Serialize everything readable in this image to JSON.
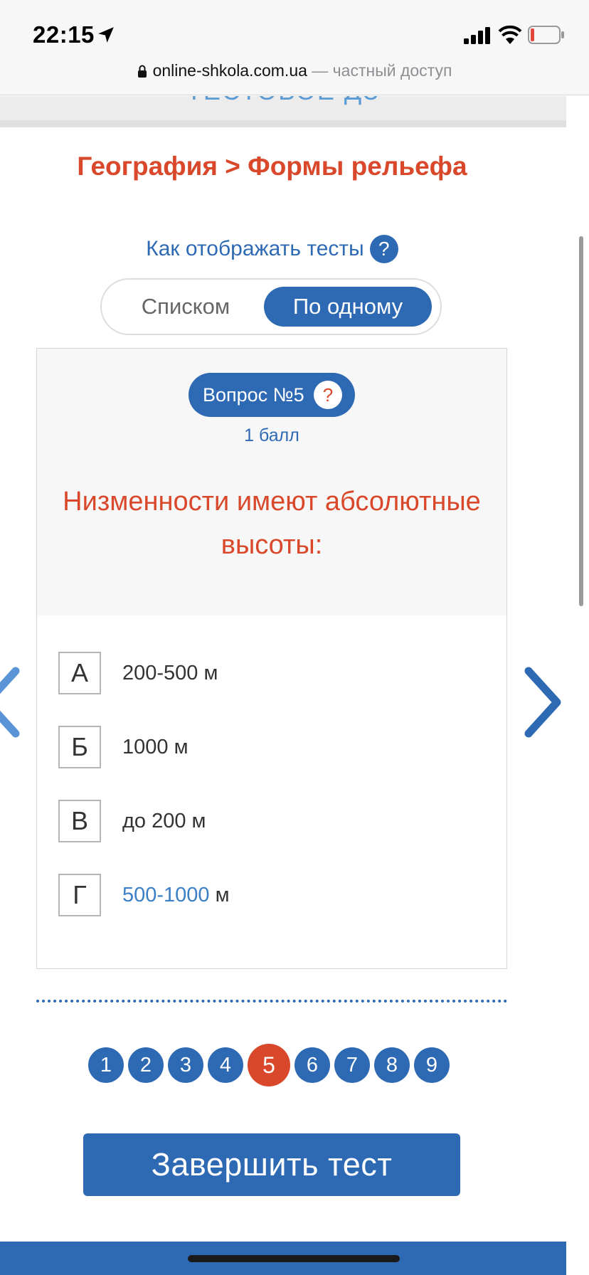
{
  "status_bar": {
    "time": "22:15",
    "icons": [
      "location-arrow-icon",
      "cellular-signal-icon",
      "wifi-icon",
      "battery-low-icon"
    ],
    "battery_color": "#e0463a"
  },
  "browser": {
    "url_host": "online-shkola.com.ua",
    "url_note": " — частный доступ"
  },
  "header": {
    "cut_off_text": "ТЕСТОВОЕ ДЗ"
  },
  "breadcrumb": "География > Формы рельефа",
  "display_mode": {
    "label": "Как отображать тесты",
    "help": "?",
    "options": [
      "Списком",
      "По одному"
    ],
    "selected": "По одному"
  },
  "question": {
    "badge": "Вопрос №5",
    "help": "?",
    "points": "1 балл",
    "text": "Низменности имеют абсолютные высоты:",
    "answers": [
      {
        "letter": "А",
        "text": "200-500 м"
      },
      {
        "letter": "Б",
        "text": "1000 м"
      },
      {
        "letter": "В",
        "text": "до 200 м"
      },
      {
        "letter": "Г",
        "link_text": "500-1000",
        "text": " м"
      }
    ]
  },
  "pagination": {
    "pages": [
      "1",
      "2",
      "3",
      "4",
      "5",
      "6",
      "7",
      "8",
      "9"
    ],
    "current": "5"
  },
  "finish_button": "Завершить тест",
  "colors": {
    "primary_blue": "#2e6ab4",
    "accent_red": "#d9482b",
    "card_background": "#f7f7f7"
  }
}
